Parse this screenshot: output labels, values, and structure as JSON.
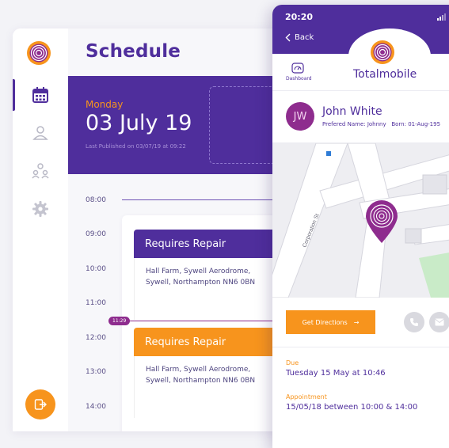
{
  "schedule": {
    "title": "Schedule",
    "day": "Monday",
    "date": "03 July 19",
    "published": "Last Published on 03/07/19 at 09:22",
    "times": [
      "08:00",
      "09:00",
      "10:00",
      "11:00",
      "12:00",
      "13:00",
      "14:00"
    ],
    "now_marker": "11:29",
    "jobs": [
      {
        "title": "Requires Repair",
        "address_line1": "Hall Farm, Sywell Aerodrome,",
        "address_line2": "Sywell, Northampton NN6 0BN",
        "color": "#4f2e9c"
      },
      {
        "title": "Requires Repair",
        "address_line1": "Hall Farm, Sywell Aerodrome,",
        "address_line2": "Sywell, Northampton NN6 0BN",
        "color": "#f7941d"
      }
    ]
  },
  "sidebar": {
    "items": [
      {
        "icon": "calendar-icon",
        "active": true
      },
      {
        "icon": "map-pin-person-icon",
        "active": false
      },
      {
        "icon": "team-icon",
        "active": false
      },
      {
        "icon": "gear-icon",
        "active": false
      }
    ],
    "logout_icon": "logout-icon"
  },
  "phone": {
    "clock": "20:20",
    "back_label": "Back",
    "dashboard_label": "Dashboard",
    "brand": "Totalmobile",
    "user": {
      "initials": "JW",
      "name": "John White",
      "preferred": "Prefered Name: Johnny",
      "born": "Born: 01-Aug-195"
    },
    "map": {
      "street_label": "Corporation St"
    },
    "directions_label": "Get Directions",
    "due_label": "Due",
    "due_value": "Tuesday 15 May at 10:46",
    "appointment_label": "Appointment",
    "appointment_value": "15/05/18 between 10:00 & 14:00"
  },
  "colors": {
    "brand_purple": "#4f2e9c",
    "accent_orange": "#f7941d",
    "magenta": "#8e2c8e"
  }
}
